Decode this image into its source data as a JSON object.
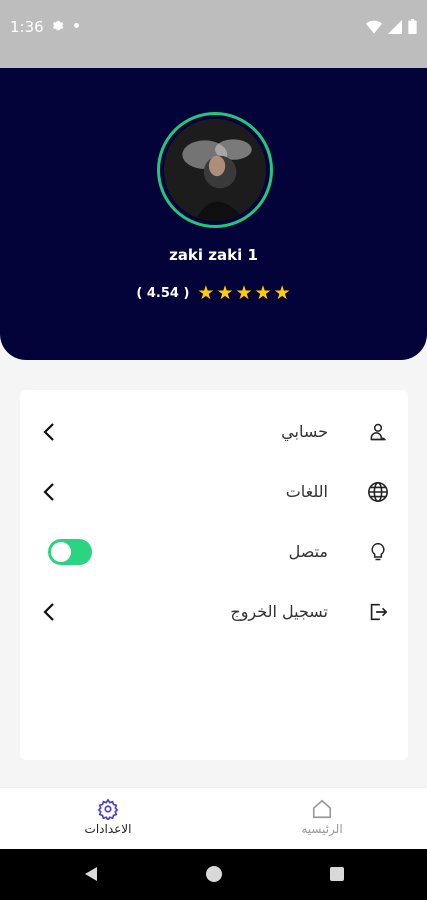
{
  "status_bar": {
    "time": "1:36"
  },
  "profile": {
    "name": "zaki zaki 1",
    "rating_text": "( 4.54 )",
    "rating_value": 4.54,
    "stars_filled": 5
  },
  "settings": {
    "items": [
      {
        "label": "حسابي",
        "icon": "user-icon",
        "control": "chevron"
      },
      {
        "label": "اللغات",
        "icon": "globe-icon",
        "control": "chevron"
      },
      {
        "label": "متصل",
        "icon": "lightbulb-icon",
        "control": "toggle",
        "toggle_on": true
      },
      {
        "label": "تسجيل الخروج",
        "icon": "logout-icon",
        "control": "chevron"
      }
    ]
  },
  "bottom_nav": {
    "settings_label": "الاعدادات",
    "home_label": "الرئيسيه",
    "active": "settings"
  },
  "colors": {
    "header_bg": "#03033a",
    "accent_green": "#22c77a",
    "star_yellow": "#ffcc00"
  }
}
